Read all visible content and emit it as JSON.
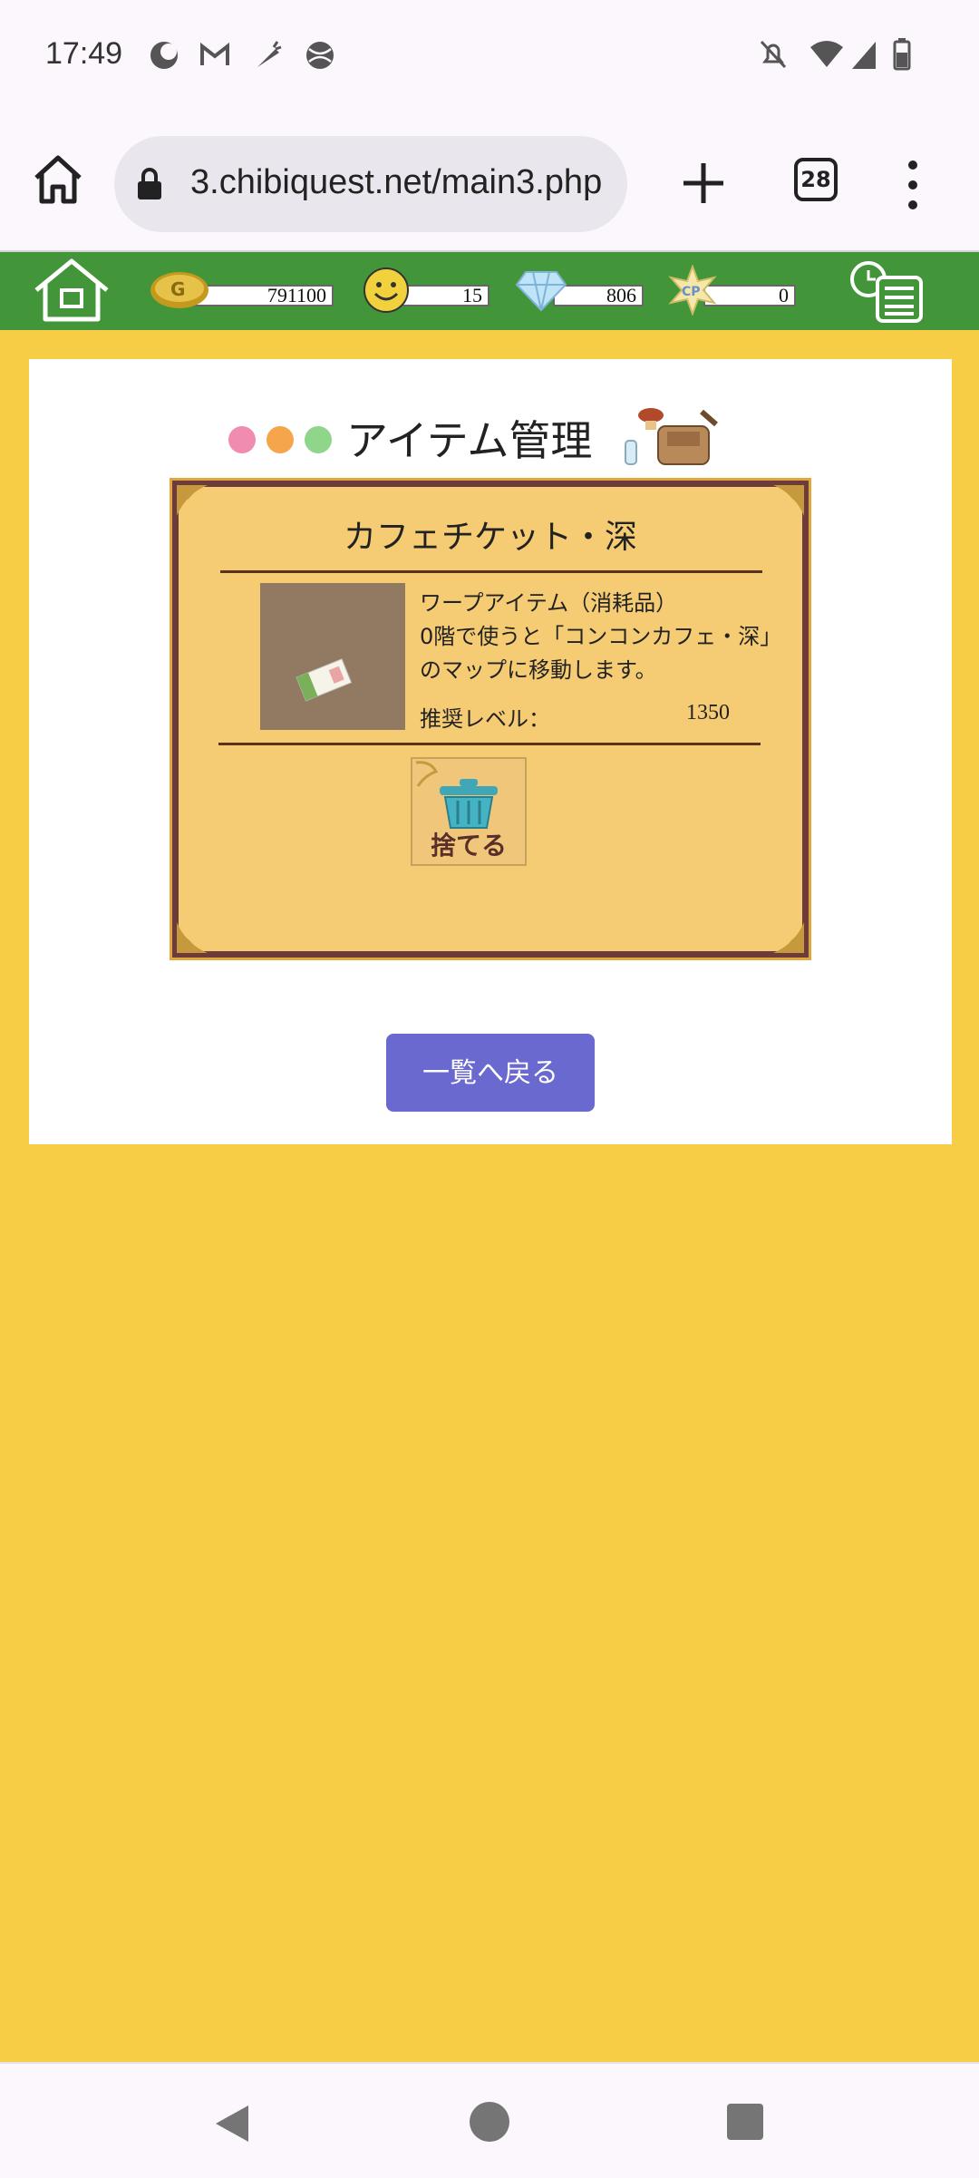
{
  "status_bar": {
    "time": "17:49"
  },
  "browser": {
    "url": "3.chibiquest.net/main3.php",
    "tab_count": "28"
  },
  "game_bar": {
    "gold": "791100",
    "smile": "15",
    "diamond": "806",
    "cp": "0",
    "cp_icon_text": "CP",
    "gold_icon_text": "G"
  },
  "panel": {
    "title": "アイテム管理",
    "item": {
      "name": "カフェチケット・深",
      "description": [
        "ワープアイテム（消耗品）",
        "0階で使うと「コンコンカフェ・深」",
        "のマップに移動します。"
      ],
      "level_label": "推奨レベル：",
      "level_value": "1350"
    },
    "discard_label": "捨てる",
    "back_button": "一覧へ戻る"
  },
  "colors": {
    "background": "#f7cd45",
    "header_green": "#43953a",
    "card": "#f5cc74",
    "card_border": "#6c3b3a",
    "back_button": "#6a69cf"
  },
  "icons": [
    "home-icon",
    "lock-icon",
    "plus-icon",
    "tabs-icon",
    "more-icon",
    "coin-icon",
    "smiley-icon",
    "diamond-icon",
    "cp-icon",
    "log-icon",
    "bag-icon",
    "trash-icon",
    "back-triangle-icon",
    "home-circle-icon",
    "recents-square-icon"
  ]
}
